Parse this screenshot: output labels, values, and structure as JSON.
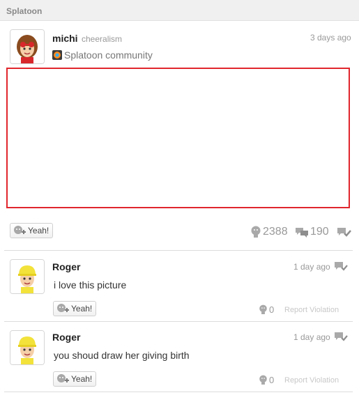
{
  "community_bar": {
    "title": "Splatoon"
  },
  "post": {
    "user_name": "michi",
    "user_tag": "cheeralism",
    "timestamp": "3 days ago",
    "community_name": "Splatoon community",
    "yeah_label": "Yeah!",
    "yeah_count": "2388",
    "comment_count": "190"
  },
  "comments": [
    {
      "user_name": "Roger",
      "timestamp": "1 day ago",
      "text": "i love this picture",
      "yeah_label": "Yeah!",
      "yeah_count": "0",
      "report_label": "Report Violation"
    },
    {
      "user_name": "Roger",
      "timestamp": "1 day ago",
      "text": "you shoud draw her giving birth",
      "yeah_label": "Yeah!",
      "yeah_count": "0",
      "report_label": "Report Violation"
    }
  ],
  "colors": {
    "highlight_border": "#e0262c",
    "muted": "#999999"
  }
}
